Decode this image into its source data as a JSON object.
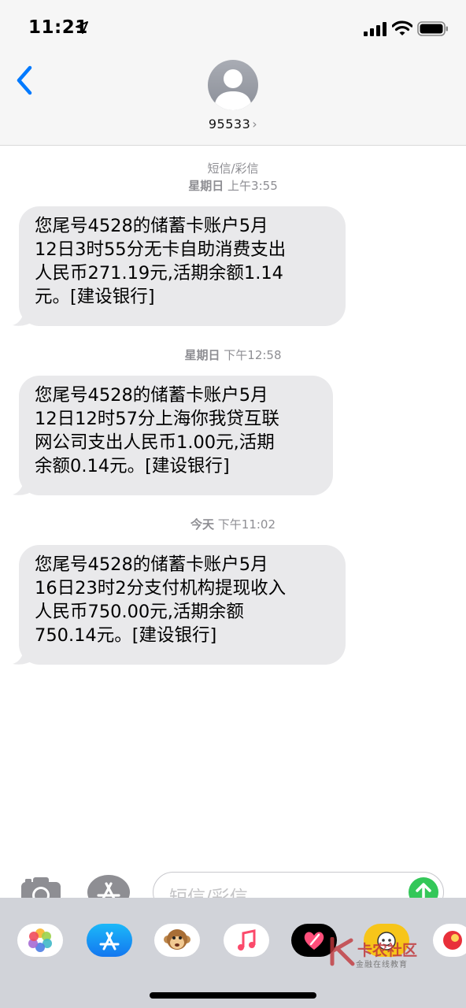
{
  "status_bar": {
    "time": "11:21"
  },
  "header": {
    "contact_name": "95533",
    "chevron": "›"
  },
  "conversation": [
    {
      "timestamp_service": "短信/彩信",
      "timestamp_day": "星期日",
      "timestamp_time": "上午3:55",
      "message": "您尾号4528的储蓄卡账户5月\n12日3时55分无卡自助消费支出\n人民币271.19元,活期余额1.14\n元。[建设银行]"
    },
    {
      "timestamp_day": "星期日",
      "timestamp_time": "下午12:58",
      "message": "您尾号4528的储蓄卡账户5月\n12日12时57分上海你我贷互联\n网公司支出人民币1.00元,活期\n余额0.14元。[建设银行]"
    },
    {
      "timestamp_day": "今天",
      "timestamp_time": "下午11:02",
      "message": "您尾号4528的储蓄卡账户5月\n16日23时2分支付机构提现收入\n人民币750.00元,活期余额\n750.14元。[建设银行]"
    }
  ],
  "input_bar": {
    "placeholder": "短信/彩信"
  },
  "app_strip": {
    "icons": [
      "photos-icon",
      "app-store-icon",
      "animoji-icon",
      "music-icon",
      "digital-touch-icon",
      "sticker-app-icon",
      "extra-app-icon"
    ],
    "watermark_title": "卡农社区",
    "watermark_sub": "金融在线教育"
  },
  "colors": {
    "accent_blue": "#007aff",
    "bubble_gray": "#e9e9eb",
    "send_green": "#34c759"
  }
}
